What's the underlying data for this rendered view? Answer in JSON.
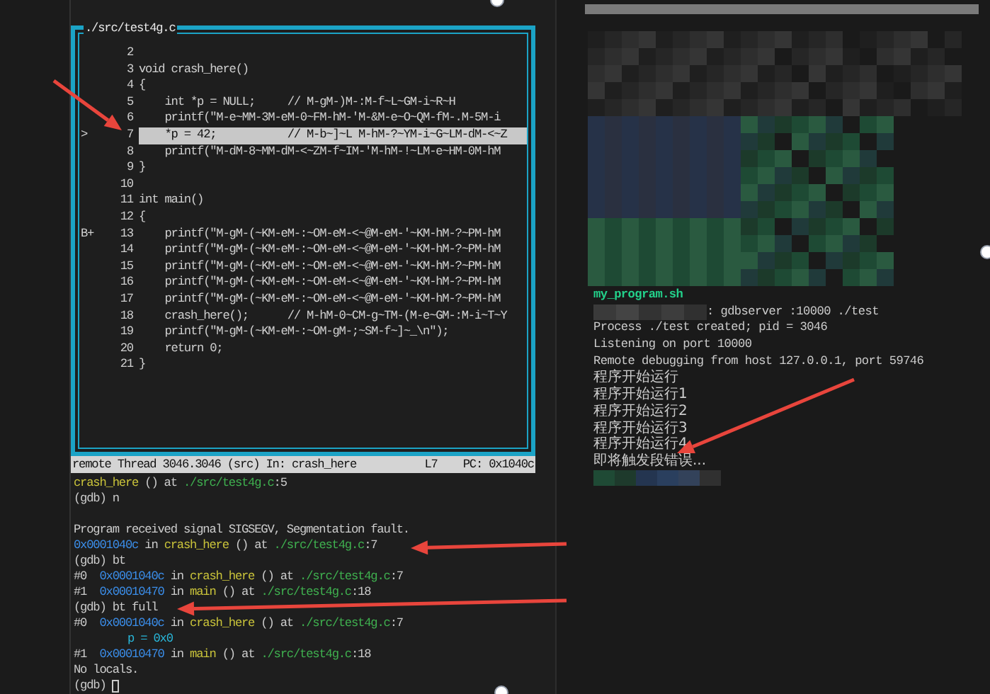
{
  "source_window": {
    "title": "./src/test4g.c",
    "lines": [
      {
        "number": "2",
        "selected": false
      },
      {
        "number": "3",
        "code": "void crash_here()",
        "selected": false
      },
      {
        "number": "4",
        "code": "{",
        "selected": false
      },
      {
        "number": "5",
        "code": "    int *p = NULL;     // M-gM-)M-:M-f~L~GM-i~R~H",
        "selected": false
      },
      {
        "number": "6",
        "code": "    printf(\"M-e~MM-3M-eM-0~FM-hM-'M-&M-e~O~QM-fM-.M-5M-i",
        "selected": false
      },
      {
        "number": "7",
        "code": "    *p = 42;           // M-b~]~L M-hM-?~YM-i~G~LM-dM-<~Z",
        "selected": true,
        "marker": ">"
      },
      {
        "number": "8",
        "code": "    printf(\"M-dM-8~MM-dM-<~ZM-f~IM-'M-hM-!~LM-e~HM-0M-hM",
        "selected": false
      },
      {
        "number": "9",
        "code": "}",
        "selected": false
      },
      {
        "number": "10",
        "selected": false
      },
      {
        "number": "11",
        "code": "int main()",
        "selected": false
      },
      {
        "number": "12",
        "code": "{",
        "selected": false
      },
      {
        "number": "13",
        "code": "    printf(\"M-gM-(~KM-eM-:~OM-eM-<~@M-eM-'~KM-hM-?~PM-hM",
        "selected": false,
        "marker": "B+"
      },
      {
        "number": "14",
        "code": "    printf(\"M-gM-(~KM-eM-:~OM-eM-<~@M-eM-'~KM-hM-?~PM-hM",
        "selected": false
      },
      {
        "number": "15",
        "code": "    printf(\"M-gM-(~KM-eM-:~OM-eM-<~@M-eM-'~KM-hM-?~PM-hM",
        "selected": false
      },
      {
        "number": "16",
        "code": "    printf(\"M-gM-(~KM-eM-:~OM-eM-<~@M-eM-'~KM-hM-?~PM-hM",
        "selected": false
      },
      {
        "number": "17",
        "code": "    printf(\"M-gM-(~KM-eM-:~OM-eM-<~@M-eM-'~KM-hM-?~PM-hM",
        "selected": false
      },
      {
        "number": "18",
        "code": "    crash_here();      // M-hM-0~CM-g~TM-(M-e~GM-:M-i~T~Y",
        "selected": false
      },
      {
        "number": "19",
        "code": "    printf(\"M-gM-(~KM-eM-:~OM-gM-;~SM-f~]~_\\n\");",
        "selected": false
      },
      {
        "number": "20",
        "code": "    return 0;",
        "selected": false
      },
      {
        "number": "21",
        "code": "}",
        "selected": false
      }
    ]
  },
  "status_bar": {
    "location": "remote Thread 3046.3046 (src) In: crash_here",
    "line": "L7",
    "pc": "PC: 0x1040c"
  },
  "gdb_console": {
    "lines": [
      {
        "kind": "text",
        "cursor": false,
        "segments": [
          {
            "kind": "func",
            "text": "crash_here"
          },
          {
            "kind": "plain",
            "text": " () at "
          },
          {
            "kind": "file",
            "text": "./src/test4g.c"
          },
          {
            "kind": "plain",
            "text": ":5"
          }
        ]
      },
      {
        "kind": "text",
        "cursor": false,
        "segments": [
          {
            "kind": "plain",
            "text": "(gdb) n"
          }
        ]
      },
      {
        "kind": "blank",
        "cursor": false
      },
      {
        "kind": "text",
        "cursor": false,
        "segments": [
          {
            "kind": "plain",
            "text": "Program received signal SIGSEGV, Segmentation fault."
          }
        ]
      },
      {
        "kind": "text",
        "cursor": false,
        "segments": [
          {
            "kind": "addr",
            "text": "0x0001040c"
          },
          {
            "kind": "plain",
            "text": " in "
          },
          {
            "kind": "func",
            "text": "crash_here"
          },
          {
            "kind": "plain",
            "text": " () at "
          },
          {
            "kind": "file",
            "text": "./src/test4g.c"
          },
          {
            "kind": "plain",
            "text": ":7"
          }
        ]
      },
      {
        "kind": "text",
        "cursor": false,
        "segments": [
          {
            "kind": "plain",
            "text": "(gdb) bt"
          }
        ]
      },
      {
        "kind": "text",
        "cursor": false,
        "segments": [
          {
            "kind": "plain",
            "text": "#0  "
          },
          {
            "kind": "addr",
            "text": "0x0001040c"
          },
          {
            "kind": "plain",
            "text": " in "
          },
          {
            "kind": "func",
            "text": "crash_here"
          },
          {
            "kind": "plain",
            "text": " () at "
          },
          {
            "kind": "file",
            "text": "./src/test4g.c"
          },
          {
            "kind": "plain",
            "text": ":7"
          }
        ]
      },
      {
        "kind": "text",
        "cursor": false,
        "segments": [
          {
            "kind": "plain",
            "text": "#1  "
          },
          {
            "kind": "addr",
            "text": "0x00010470"
          },
          {
            "kind": "plain",
            "text": " in "
          },
          {
            "kind": "func",
            "text": "main"
          },
          {
            "kind": "plain",
            "text": " () at "
          },
          {
            "kind": "file",
            "text": "./src/test4g.c"
          },
          {
            "kind": "plain",
            "text": ":18"
          }
        ]
      },
      {
        "kind": "text",
        "cursor": false,
        "segments": [
          {
            "kind": "plain",
            "text": "(gdb) bt full"
          }
        ]
      },
      {
        "kind": "text",
        "cursor": false,
        "segments": [
          {
            "kind": "plain",
            "text": "#0  "
          },
          {
            "kind": "addr",
            "text": "0x0001040c"
          },
          {
            "kind": "plain",
            "text": " in "
          },
          {
            "kind": "func",
            "text": "crash_here"
          },
          {
            "kind": "plain",
            "text": " () at "
          },
          {
            "kind": "file",
            "text": "./src/test4g.c"
          },
          {
            "kind": "plain",
            "text": ":7"
          }
        ]
      },
      {
        "kind": "indented",
        "cursor": false,
        "segments": [
          {
            "kind": "var",
            "text": "p = 0x0"
          }
        ]
      },
      {
        "kind": "text",
        "cursor": false,
        "segments": [
          {
            "kind": "plain",
            "text": "#1  "
          },
          {
            "kind": "addr",
            "text": "0x00010470"
          },
          {
            "kind": "plain",
            "text": " in "
          },
          {
            "kind": "func",
            "text": "main"
          },
          {
            "kind": "plain",
            "text": " () at "
          },
          {
            "kind": "file",
            "text": "./src/test4g.c"
          },
          {
            "kind": "plain",
            "text": ":18"
          }
        ]
      },
      {
        "kind": "text",
        "cursor": false,
        "segments": [
          {
            "kind": "plain",
            "text": "No locals."
          }
        ]
      },
      {
        "kind": "text",
        "cursor": true,
        "segments": [
          {
            "kind": "plain",
            "text": "(gdb)"
          }
        ]
      }
    ]
  },
  "server_terminal": {
    "lines": [
      {
        "kind": "script",
        "text": "my_program.sh"
      },
      {
        "kind": "redacted_prefix",
        "text": ": gdbserver :10000 ./test"
      },
      {
        "kind": "output",
        "text": "Process ./test created; pid = 3046"
      },
      {
        "kind": "output",
        "text": "Listening on port 10000"
      },
      {
        "kind": "output",
        "text": "Remote debugging from host 127.0.0.1, port 59746"
      },
      {
        "kind": "output",
        "text": "程序开始运行"
      },
      {
        "kind": "output",
        "text": "程序开始运行1"
      },
      {
        "kind": "output",
        "text": "程序开始运行2"
      },
      {
        "kind": "output",
        "text": "程序开始运行3"
      },
      {
        "kind": "output",
        "text": "程序开始运行4"
      },
      {
        "kind": "output",
        "text": "即将触发段错误..."
      },
      {
        "kind": "redacted"
      }
    ]
  }
}
